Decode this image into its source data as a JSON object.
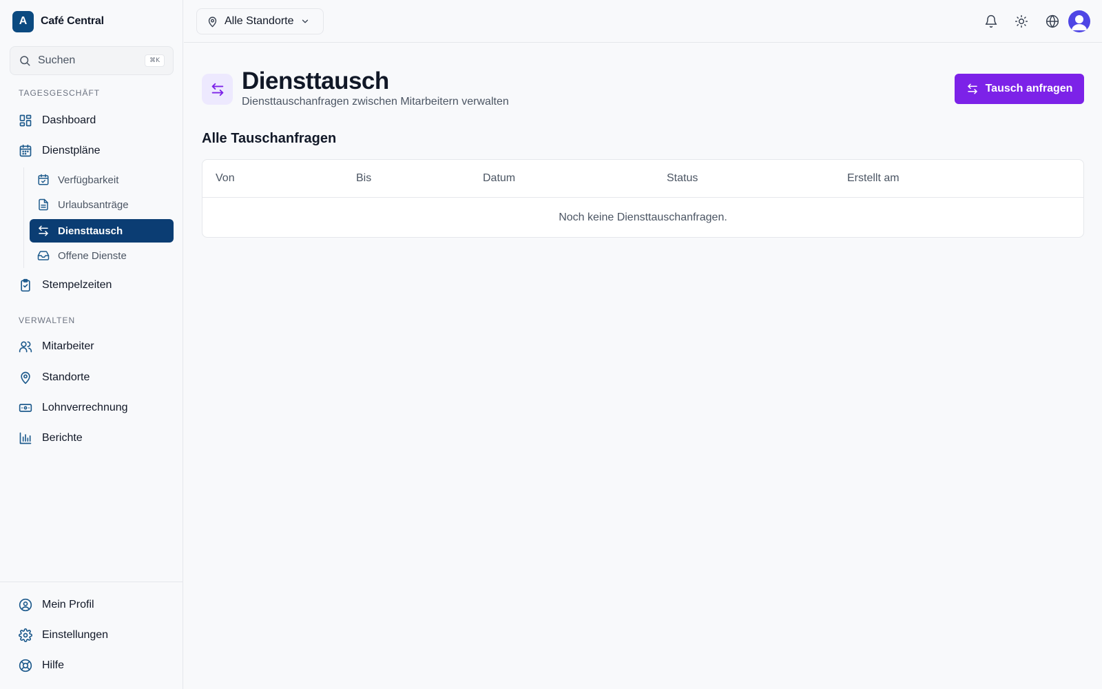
{
  "brand": {
    "logo_letter": "A",
    "name": "Café Central"
  },
  "search": {
    "placeholder": "Suchen",
    "shortcut": "⌘K"
  },
  "sidebar": {
    "sections": [
      {
        "label": "TAGESGESCHÄFT"
      },
      {
        "label": "VERWALTEN"
      }
    ],
    "items": [
      {
        "label": "Dashboard",
        "icon": "dashboard-icon"
      },
      {
        "label": "Dienstpläne",
        "icon": "calendar-icon"
      },
      {
        "label": "Stempelzeiten",
        "icon": "clipboard-check-icon"
      },
      {
        "label": "Mitarbeiter",
        "icon": "users-icon"
      },
      {
        "label": "Standorte",
        "icon": "map-pin-icon"
      },
      {
        "label": "Lohnverrechnung",
        "icon": "banknote-icon"
      },
      {
        "label": "Berichte",
        "icon": "bar-chart-icon"
      }
    ],
    "sub_items": [
      {
        "label": "Verfügbarkeit",
        "icon": "calendar-check-icon"
      },
      {
        "label": "Urlaubsanträge",
        "icon": "file-text-icon"
      },
      {
        "label": "Diensttausch",
        "icon": "swap-icon",
        "active": true
      },
      {
        "label": "Offene Dienste",
        "icon": "inbox-icon"
      }
    ],
    "bottom_items": [
      {
        "label": "Mein Profil",
        "icon": "user-circle-icon"
      },
      {
        "label": "Einstellungen",
        "icon": "gear-icon"
      },
      {
        "label": "Hilfe",
        "icon": "lifebuoy-icon"
      }
    ]
  },
  "topbar": {
    "location_select": "Alle Standorte",
    "icons": [
      "bell-icon",
      "sun-icon",
      "globe-icon",
      "avatar"
    ]
  },
  "page": {
    "title": "Diensttausch",
    "subtitle": "Diensttauschanfragen zwischen Mitarbeitern verwalten",
    "primary_action": "Tausch anfragen",
    "section_title": "Alle Tauschanfragen"
  },
  "table": {
    "columns": [
      "Von",
      "Bis",
      "Datum",
      "Status",
      "Erstellt am"
    ],
    "rows": [],
    "empty_message": "Noch keine Diensttauschanfragen."
  },
  "colors": {
    "brand": "#0b4a80",
    "active_nav": "#0b3d73",
    "primary": "#7c22e8",
    "icon_accent": "#1d5a8c"
  }
}
